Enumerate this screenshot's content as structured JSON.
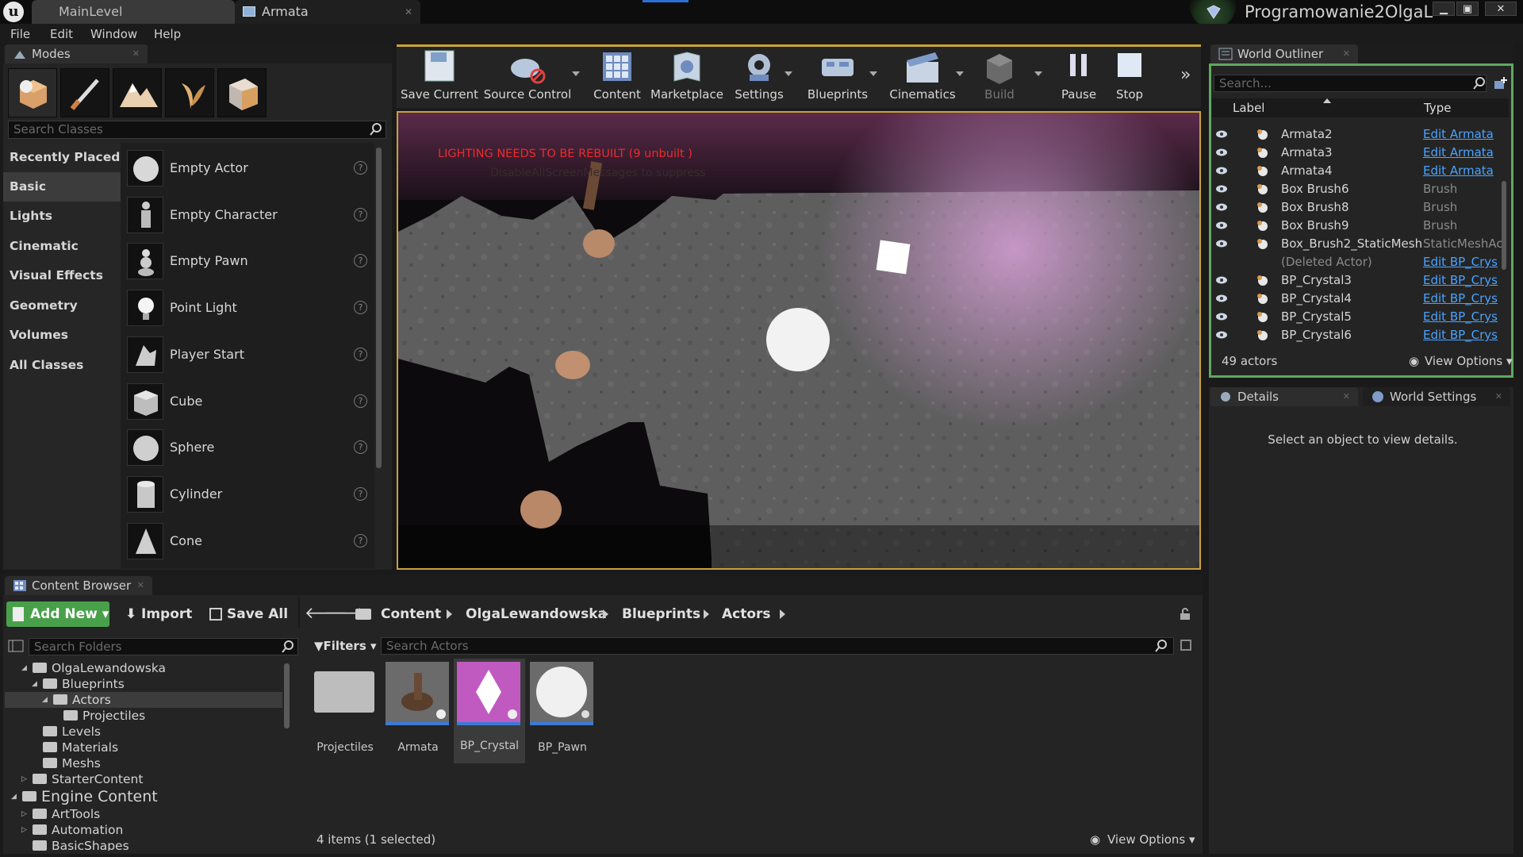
{
  "title_bar": {
    "tabs": [
      {
        "label": "MainLevel"
      },
      {
        "label": "Armata"
      }
    ],
    "project_name": "Programowanie2OlgaL"
  },
  "menu": {
    "items": [
      "File",
      "Edit",
      "Window",
      "Help"
    ]
  },
  "modes": {
    "tab_label": "Modes",
    "search_placeholder": "Search Classes",
    "categories": [
      "Recently Placed",
      "Basic",
      "Lights",
      "Cinematic",
      "Visual Effects",
      "Geometry",
      "Volumes",
      "All Classes"
    ],
    "active_category": "Basic",
    "classes": [
      "Empty Actor",
      "Empty Character",
      "Empty Pawn",
      "Point Light",
      "Player Start",
      "Cube",
      "Sphere",
      "Cylinder",
      "Cone"
    ]
  },
  "toolbar": {
    "buttons": [
      "Save Current",
      "Source Control",
      "Content",
      "Marketplace",
      "Settings",
      "Blueprints",
      "Cinematics",
      "Build",
      "Pause",
      "Stop"
    ]
  },
  "viewport": {
    "warning": "LIGHTING NEEDS TO BE REBUILT (9 unbuilt )",
    "subwarning": "DisableAllScreenMessages to suppress"
  },
  "outliner": {
    "tab_label": "World Outliner",
    "search_placeholder": "Search...",
    "col_label": "Label",
    "col_type": "Type",
    "rows": [
      {
        "name": "Armata2",
        "type": "Edit Armata",
        "link": true
      },
      {
        "name": "Armata3",
        "type": "Edit Armata",
        "link": true
      },
      {
        "name": "Armata4",
        "type": "Edit Armata",
        "link": true
      },
      {
        "name": "Box Brush6",
        "type": "Brush",
        "link": false
      },
      {
        "name": "Box Brush8",
        "type": "Brush",
        "link": false
      },
      {
        "name": "Box Brush9",
        "type": "Brush",
        "link": false
      },
      {
        "name": "Box_Brush2_StaticMesh",
        "type": "StaticMeshAc",
        "link": false
      },
      {
        "name": "(Deleted Actor)",
        "type": "Edit BP_Crys",
        "link": true
      },
      {
        "name": "BP_Crystal3",
        "type": "Edit BP_Crys",
        "link": true
      },
      {
        "name": "BP_Crystal4",
        "type": "Edit BP_Crys",
        "link": true
      },
      {
        "name": "BP_Crystal5",
        "type": "Edit BP_Crys",
        "link": true
      },
      {
        "name": "BP_Crystal6",
        "type": "Edit BP_Crys",
        "link": true
      }
    ],
    "count": "49 actors",
    "view_options": "View Options"
  },
  "details": {
    "tab_details": "Details",
    "tab_world_settings": "World Settings",
    "empty_message": "Select an object to view details."
  },
  "content_browser": {
    "tab_label": "Content Browser",
    "add_new": "Add New",
    "import": "Import",
    "save_all": "Save All",
    "breadcrumb": [
      "Content",
      "OlgaLewandowska",
      "Blueprints",
      "Actors"
    ],
    "search_folders_placeholder": "Search Folders",
    "filters": "Filters",
    "search_actors_placeholder": "Search Actors",
    "tree": [
      {
        "label": "OlgaLewandowska",
        "level": 1,
        "arrow": "open"
      },
      {
        "label": "Blueprints",
        "level": 2,
        "arrow": "open"
      },
      {
        "label": "Actors",
        "level": 3,
        "arrow": "open",
        "selected": true
      },
      {
        "label": "Projectiles",
        "level": 4,
        "arrow": ""
      },
      {
        "label": "Levels",
        "level": 2,
        "arrow": ""
      },
      {
        "label": "Materials",
        "level": 2,
        "arrow": ""
      },
      {
        "label": "Meshs",
        "level": 2,
        "arrow": ""
      },
      {
        "label": "StarterContent",
        "level": 1,
        "arrow": "closed"
      },
      {
        "label": "Engine Content",
        "level": 0,
        "arrow": "open",
        "big": true
      },
      {
        "label": "ArtTools",
        "level": 1,
        "arrow": "closed"
      },
      {
        "label": "Automation",
        "level": 1,
        "arrow": "closed"
      },
      {
        "label": "BasicShapes",
        "level": 1,
        "arrow": ""
      }
    ],
    "assets": [
      "Projectiles",
      "Armata",
      "BP_Crystal",
      "BP_Pawn"
    ],
    "selected_asset": "BP_Crystal",
    "status": "4 items (1 selected)",
    "view_options": "View Options"
  }
}
